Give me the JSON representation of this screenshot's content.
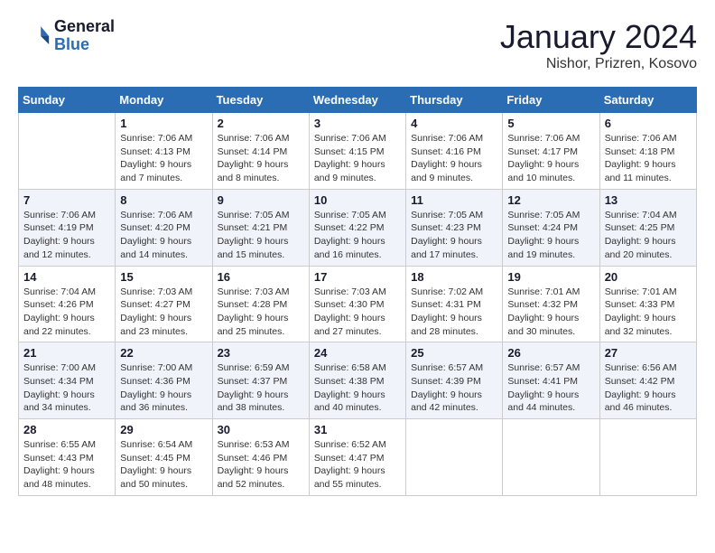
{
  "header": {
    "logo_line1": "General",
    "logo_line2": "Blue",
    "month": "January 2024",
    "location": "Nishor, Prizren, Kosovo"
  },
  "days_of_week": [
    "Sunday",
    "Monday",
    "Tuesday",
    "Wednesday",
    "Thursday",
    "Friday",
    "Saturday"
  ],
  "weeks": [
    [
      {
        "day": "",
        "info": ""
      },
      {
        "day": "1",
        "info": "Sunrise: 7:06 AM\nSunset: 4:13 PM\nDaylight: 9 hours\nand 7 minutes."
      },
      {
        "day": "2",
        "info": "Sunrise: 7:06 AM\nSunset: 4:14 PM\nDaylight: 9 hours\nand 8 minutes."
      },
      {
        "day": "3",
        "info": "Sunrise: 7:06 AM\nSunset: 4:15 PM\nDaylight: 9 hours\nand 9 minutes."
      },
      {
        "day": "4",
        "info": "Sunrise: 7:06 AM\nSunset: 4:16 PM\nDaylight: 9 hours\nand 9 minutes."
      },
      {
        "day": "5",
        "info": "Sunrise: 7:06 AM\nSunset: 4:17 PM\nDaylight: 9 hours\nand 10 minutes."
      },
      {
        "day": "6",
        "info": "Sunrise: 7:06 AM\nSunset: 4:18 PM\nDaylight: 9 hours\nand 11 minutes."
      }
    ],
    [
      {
        "day": "7",
        "info": "Sunrise: 7:06 AM\nSunset: 4:19 PM\nDaylight: 9 hours\nand 12 minutes."
      },
      {
        "day": "8",
        "info": "Sunrise: 7:06 AM\nSunset: 4:20 PM\nDaylight: 9 hours\nand 14 minutes."
      },
      {
        "day": "9",
        "info": "Sunrise: 7:05 AM\nSunset: 4:21 PM\nDaylight: 9 hours\nand 15 minutes."
      },
      {
        "day": "10",
        "info": "Sunrise: 7:05 AM\nSunset: 4:22 PM\nDaylight: 9 hours\nand 16 minutes."
      },
      {
        "day": "11",
        "info": "Sunrise: 7:05 AM\nSunset: 4:23 PM\nDaylight: 9 hours\nand 17 minutes."
      },
      {
        "day": "12",
        "info": "Sunrise: 7:05 AM\nSunset: 4:24 PM\nDaylight: 9 hours\nand 19 minutes."
      },
      {
        "day": "13",
        "info": "Sunrise: 7:04 AM\nSunset: 4:25 PM\nDaylight: 9 hours\nand 20 minutes."
      }
    ],
    [
      {
        "day": "14",
        "info": "Sunrise: 7:04 AM\nSunset: 4:26 PM\nDaylight: 9 hours\nand 22 minutes."
      },
      {
        "day": "15",
        "info": "Sunrise: 7:03 AM\nSunset: 4:27 PM\nDaylight: 9 hours\nand 23 minutes."
      },
      {
        "day": "16",
        "info": "Sunrise: 7:03 AM\nSunset: 4:28 PM\nDaylight: 9 hours\nand 25 minutes."
      },
      {
        "day": "17",
        "info": "Sunrise: 7:03 AM\nSunset: 4:30 PM\nDaylight: 9 hours\nand 27 minutes."
      },
      {
        "day": "18",
        "info": "Sunrise: 7:02 AM\nSunset: 4:31 PM\nDaylight: 9 hours\nand 28 minutes."
      },
      {
        "day": "19",
        "info": "Sunrise: 7:01 AM\nSunset: 4:32 PM\nDaylight: 9 hours\nand 30 minutes."
      },
      {
        "day": "20",
        "info": "Sunrise: 7:01 AM\nSunset: 4:33 PM\nDaylight: 9 hours\nand 32 minutes."
      }
    ],
    [
      {
        "day": "21",
        "info": "Sunrise: 7:00 AM\nSunset: 4:34 PM\nDaylight: 9 hours\nand 34 minutes."
      },
      {
        "day": "22",
        "info": "Sunrise: 7:00 AM\nSunset: 4:36 PM\nDaylight: 9 hours\nand 36 minutes."
      },
      {
        "day": "23",
        "info": "Sunrise: 6:59 AM\nSunset: 4:37 PM\nDaylight: 9 hours\nand 38 minutes."
      },
      {
        "day": "24",
        "info": "Sunrise: 6:58 AM\nSunset: 4:38 PM\nDaylight: 9 hours\nand 40 minutes."
      },
      {
        "day": "25",
        "info": "Sunrise: 6:57 AM\nSunset: 4:39 PM\nDaylight: 9 hours\nand 42 minutes."
      },
      {
        "day": "26",
        "info": "Sunrise: 6:57 AM\nSunset: 4:41 PM\nDaylight: 9 hours\nand 44 minutes."
      },
      {
        "day": "27",
        "info": "Sunrise: 6:56 AM\nSunset: 4:42 PM\nDaylight: 9 hours\nand 46 minutes."
      }
    ],
    [
      {
        "day": "28",
        "info": "Sunrise: 6:55 AM\nSunset: 4:43 PM\nDaylight: 9 hours\nand 48 minutes."
      },
      {
        "day": "29",
        "info": "Sunrise: 6:54 AM\nSunset: 4:45 PM\nDaylight: 9 hours\nand 50 minutes."
      },
      {
        "day": "30",
        "info": "Sunrise: 6:53 AM\nSunset: 4:46 PM\nDaylight: 9 hours\nand 52 minutes."
      },
      {
        "day": "31",
        "info": "Sunrise: 6:52 AM\nSunset: 4:47 PM\nDaylight: 9 hours\nand 55 minutes."
      },
      {
        "day": "",
        "info": ""
      },
      {
        "day": "",
        "info": ""
      },
      {
        "day": "",
        "info": ""
      }
    ]
  ]
}
